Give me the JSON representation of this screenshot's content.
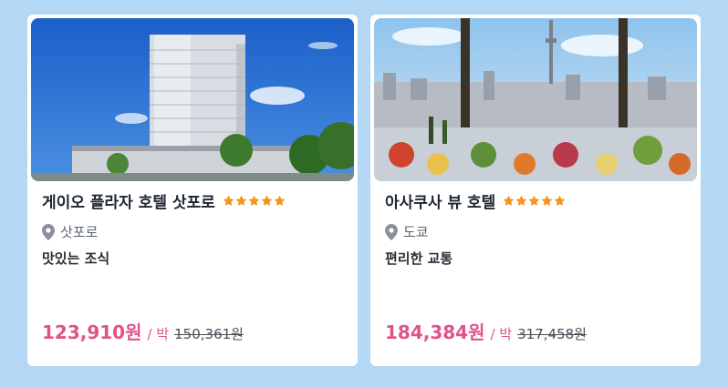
{
  "colors": {
    "background": "#b3d7f5",
    "price": "#e0528a",
    "star": "#f7931e"
  },
  "cards": [
    {
      "name": "게이오 플라자 호텔 삿포로",
      "stars": 5,
      "location": "삿포로",
      "feature": "맛있는 조식",
      "price": "123,910원",
      "unit": "/ 박",
      "original_price": "150,361원",
      "image_icon": "hotel-building-photo"
    },
    {
      "name": "아사쿠사 뷰 호텔",
      "stars": 5,
      "location": "도쿄",
      "feature": "편리한 교통",
      "price": "184,384원",
      "unit": "/ 박",
      "original_price": "317,458원",
      "image_icon": "city-view-buffet-photo"
    }
  ]
}
